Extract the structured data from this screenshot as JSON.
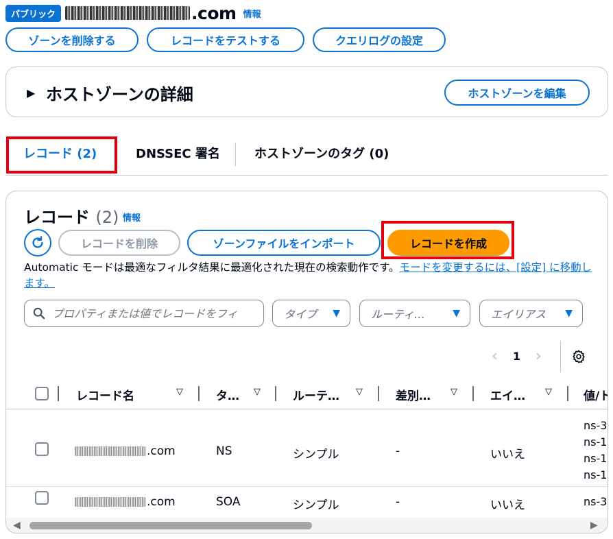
{
  "header": {
    "badge": "パブリック",
    "domain_suffix": ".com",
    "info": "情報"
  },
  "actions": {
    "delete_zone": "ゾーンを削除する",
    "test_record": "レコードをテストする",
    "query_log": "クエリログの設定"
  },
  "details": {
    "title": "ホストゾーンの詳細",
    "edit_button": "ホストゾーンを編集"
  },
  "tabs": [
    {
      "label": "レコード (2)",
      "active": true
    },
    {
      "label": "DNSSEC 署名",
      "active": false
    },
    {
      "label": "ホストゾーンのタグ (0)",
      "active": false
    }
  ],
  "records": {
    "title": "レコード",
    "count": "(2)",
    "info": "情報",
    "delete_button": "レコードを削除",
    "import_button": "ゾーンファイルをインポート",
    "create_button": "レコードを作成",
    "description": "Automatic モードは最適なフィルタ結果に最適化された現在の検索動作です。",
    "description_link": "モードを変更するには、[設定] に移動します。",
    "search_placeholder": "プロパティまたは値でレコードをフィ",
    "filters": {
      "type": "タイプ",
      "routing": "ルーティ…",
      "alias": "エイリアス"
    },
    "page": "1",
    "columns": [
      "レコード名",
      "タ…",
      "ルーテ…",
      "差別…",
      "エイ…",
      "値/ト"
    ],
    "rows": [
      {
        "name_suffix": ".com",
        "type": "NS",
        "routing": "シンプル",
        "diff": "-",
        "alias": "いいえ",
        "values": [
          "ns-3",
          "ns-1",
          "ns-1",
          "ns-1"
        ]
      },
      {
        "name_suffix": ".com",
        "type": "SOA",
        "routing": "シンプル",
        "diff": "-",
        "alias": "いいえ",
        "values": [
          "ns-3"
        ]
      }
    ]
  },
  "colors": {
    "primary": "#0972d3",
    "create": "#ff9900",
    "highlight": "#e2000f"
  }
}
